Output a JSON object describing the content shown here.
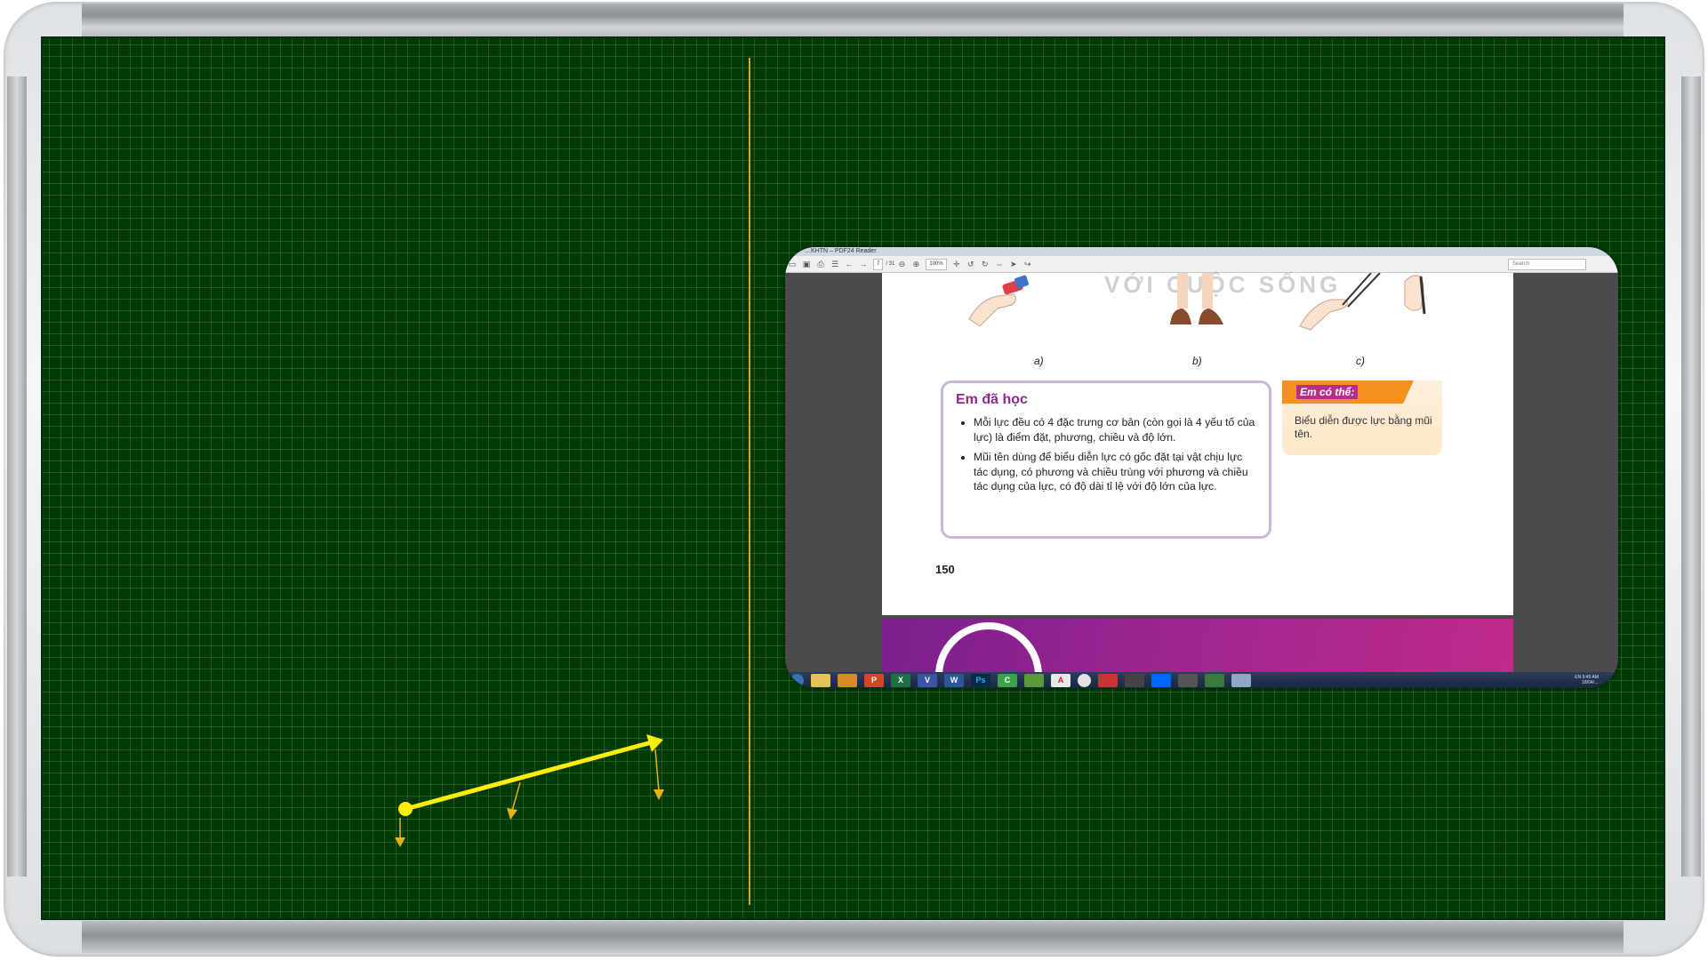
{
  "pdf_window": {
    "title": "…KHTN – PDF24 Reader",
    "toolbar": {
      "page_current": "7",
      "page_total": "/ 31",
      "zoom": "100%",
      "search_placeholder": "Search"
    },
    "page": {
      "watermark": "VỚI CUỘC SỐNG",
      "figure_labels": [
        "a)",
        "b)",
        "c)"
      ],
      "learned": {
        "title": "Em đã học",
        "bullets": [
          "Mỗi lực đều có 4 đặc trưng cơ bản (còn gọi là 4 yếu tố của lực) là điểm đặt, phương, chiều và độ lớn.",
          "Mũi tên dùng để biểu diễn lực có gốc đặt tại vật chịu lực tác dụng, có phương và chiều trùng với phương và chiều tác dụng của lực, có độ dài tỉ lệ với độ lớn của lực."
        ]
      },
      "can_do": {
        "title": "Em có thể:",
        "text": "Biểu diễn được lực bằng mũi tên."
      },
      "page_number": "150"
    },
    "taskbar": {
      "items": [
        "ie-icon",
        "folder-icon",
        "media-icon",
        "powerpoint-icon",
        "excel-icon",
        "visio-icon",
        "word-icon",
        "photoshop-icon",
        "camtasia-icon",
        "app-icon",
        "acrobat-icon",
        "chrome-icon",
        "app2-icon",
        "app3-icon",
        "zalo-icon",
        "app4-icon",
        "app5-icon",
        "paint-icon"
      ],
      "clock_time": "9:45 AM",
      "clock_date": "18/04/…",
      "lang": "EN"
    }
  },
  "colors": {
    "board": "#003a06",
    "vector": "#ffee00",
    "small_arrows": "#e8b20c",
    "divider": "#d6a722"
  }
}
